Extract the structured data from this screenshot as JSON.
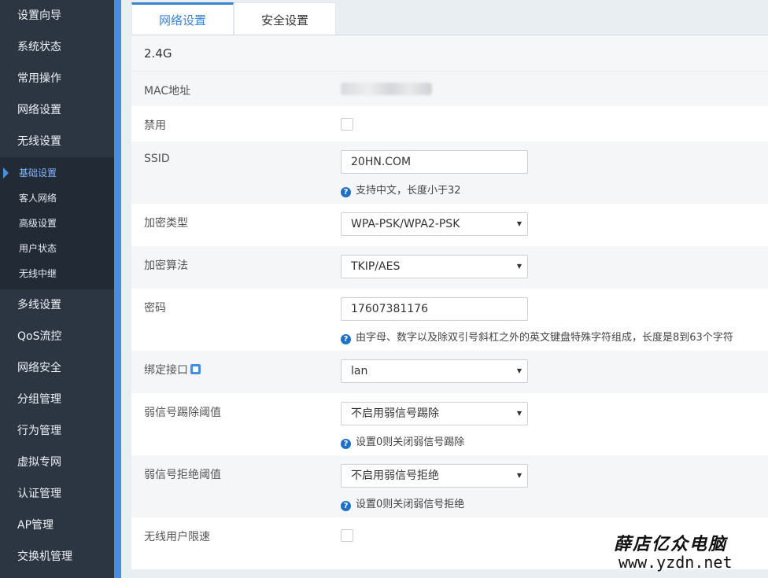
{
  "sidebar": {
    "items_top": [
      "设置向导",
      "系统状态",
      "常用操作",
      "网络设置",
      "无线设置"
    ],
    "subitems": [
      {
        "label": "基础设置",
        "active": true
      },
      {
        "label": "客人网络",
        "active": false
      },
      {
        "label": "高级设置",
        "active": false
      },
      {
        "label": "用户状态",
        "active": false
      },
      {
        "label": "无线中继",
        "active": false
      }
    ],
    "items_bottom": [
      "多线设置",
      "QoS流控",
      "网络安全",
      "分组管理",
      "行为管理",
      "虚拟专网",
      "认证管理",
      "AP管理",
      "交换机管理"
    ]
  },
  "tabs": [
    "网络设置",
    "安全设置"
  ],
  "panel": {
    "title": "2.4G",
    "mac_label": "MAC地址",
    "disable_label": "禁用",
    "ssid_label": "SSID",
    "ssid_value": "20HN.COM",
    "ssid_help": "支持中文，长度小于32",
    "enc_type_label": "加密类型",
    "enc_type_value": "WPA-PSK/WPA2-PSK",
    "enc_algo_label": "加密算法",
    "enc_algo_value": "TKIP/AES",
    "password_label": "密码",
    "password_value": "17607381176",
    "password_help": "由字母、数字以及除双引号斜杠之外的英文键盘特殊字符组成，长度是8到63个字符",
    "bind_label": "绑定接口",
    "bind_value": "lan",
    "weak_kick_label": "弱信号踢除阈值",
    "weak_kick_value": "不启用弱信号踢除",
    "weak_kick_help": "设置0则关闭弱信号踢除",
    "weak_reject_label": "弱信号拒绝阈值",
    "weak_reject_value": "不启用弱信号拒绝",
    "weak_reject_help": "设置0则关闭弱信号拒绝",
    "rate_limit_label": "无线用户限速"
  },
  "watermark": {
    "title": "薛店亿众电脑",
    "url": "www.yzdn.net"
  }
}
